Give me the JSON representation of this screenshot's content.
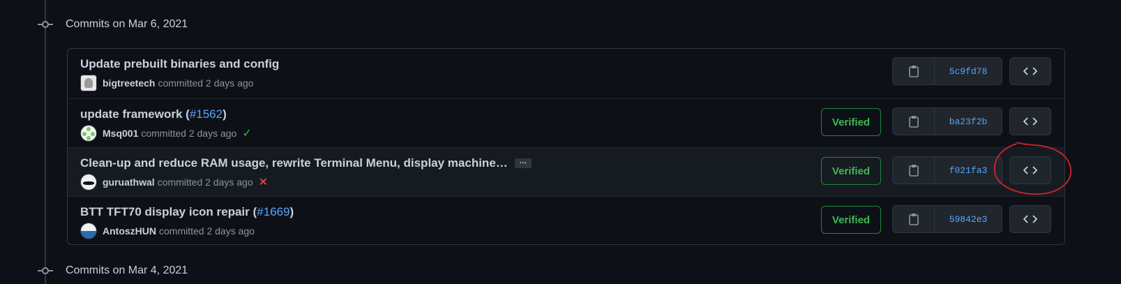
{
  "days": [
    {
      "title": "Commits on Mar 6, 2021"
    },
    {
      "title": "Commits on Mar 4, 2021"
    }
  ],
  "commits": [
    {
      "message": "Update prebuilt binaries and config",
      "pr": "",
      "pr_suffix": "",
      "author": "bigtreetech",
      "committed": "committed 2 days ago",
      "status": "",
      "verified": "",
      "sha": "5c9fd78"
    },
    {
      "message": "update framework (",
      "pr": "#1562",
      "pr_suffix": ")",
      "author": "Msq001",
      "committed": "committed 2 days ago",
      "status": "success",
      "verified": "Verified",
      "sha": "ba23f2b"
    },
    {
      "message": "Clean-up and reduce RAM usage, rewrite Terminal Menu, display machine…",
      "pr": "",
      "pr_suffix": "",
      "expand": "…",
      "author": "guruathwal",
      "committed": "committed 2 days ago",
      "status": "failure",
      "verified": "Verified",
      "sha": "f021fa3"
    },
    {
      "message": "BTT TFT70 display icon repair (",
      "pr": "#1669",
      "pr_suffix": ")",
      "author": "AntoszHUN",
      "committed": "committed 2 days ago",
      "status": "",
      "verified": "Verified",
      "sha": "59842e3"
    }
  ],
  "icons": {
    "copy": "clippy-icon",
    "browse": "code-icon",
    "success": "check-icon",
    "failure": "x-icon"
  },
  "colors": {
    "background": "#0d1117",
    "link": "#58a6ff",
    "verified": "#3fb950",
    "failure": "#f85149",
    "annotation": "#c4222b"
  }
}
